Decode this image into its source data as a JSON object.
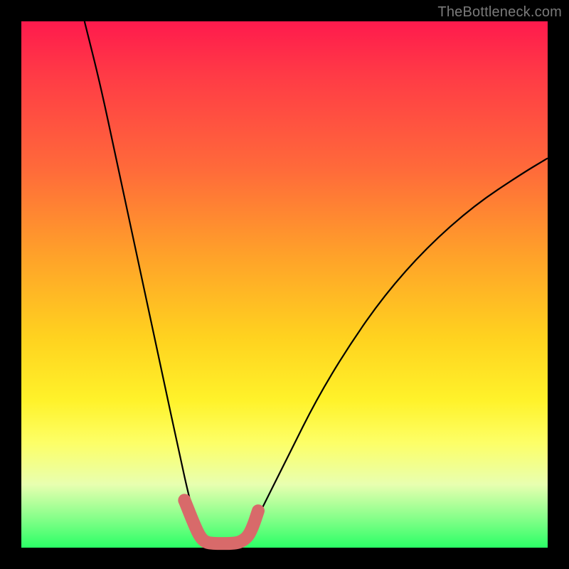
{
  "watermark": "TheBottleneck.com",
  "chart_data": {
    "type": "line",
    "title": "",
    "xlabel": "",
    "ylabel": "",
    "xlim": [
      0,
      100
    ],
    "ylim": [
      0,
      100
    ],
    "grid": false,
    "legend": false,
    "series": [
      {
        "name": "left-curve",
        "x": [
          12,
          15,
          18,
          21,
          24,
          27,
          30,
          32,
          33.5,
          34.5,
          35
        ],
        "values": [
          100,
          88,
          74,
          60,
          46,
          32,
          18,
          9,
          4,
          1.5,
          1
        ]
      },
      {
        "name": "right-curve",
        "x": [
          42,
          44,
          47,
          51,
          56,
          62,
          69,
          77,
          86,
          95,
          100
        ],
        "values": [
          1,
          4,
          10,
          18,
          28,
          38,
          48,
          57,
          65,
          71,
          74
        ]
      },
      {
        "name": "valley-outline",
        "x": [
          31,
          33,
          34,
          35,
          36.5,
          38,
          40,
          41.5,
          43,
          44,
          45
        ],
        "values": [
          9,
          4,
          2,
          1,
          0.8,
          0.8,
          0.8,
          1,
          2,
          4,
          7
        ]
      }
    ],
    "colors": {
      "curve": "#000000",
      "valley": "#d86a6a"
    },
    "gradient_stops": [
      {
        "pos": 0,
        "color": "#ff1a4d"
      },
      {
        "pos": 28,
        "color": "#ff6a3a"
      },
      {
        "pos": 60,
        "color": "#ffd21f"
      },
      {
        "pos": 80,
        "color": "#fdff66"
      },
      {
        "pos": 100,
        "color": "#2bff66"
      }
    ]
  }
}
